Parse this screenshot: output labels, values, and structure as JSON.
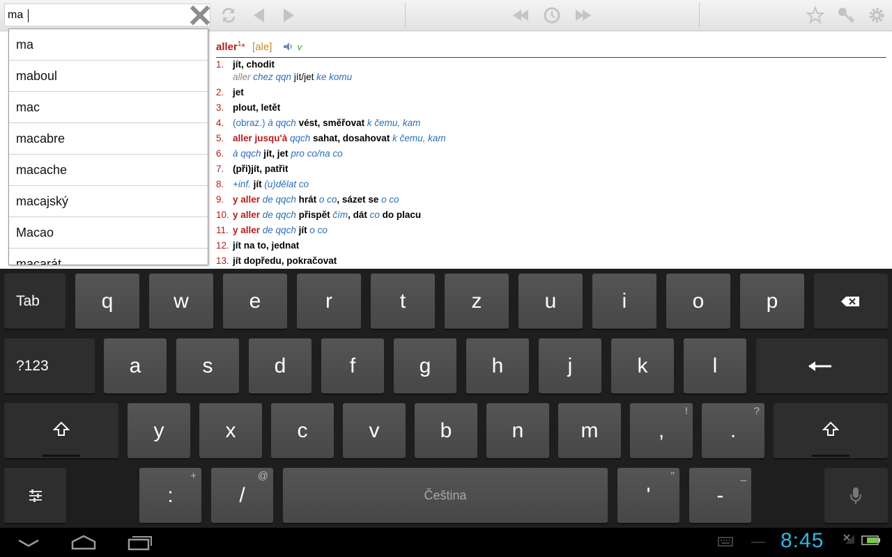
{
  "search": {
    "value": "ma"
  },
  "toolbar": {
    "icons": [
      "clear-icon",
      "refresh-icon",
      "back-arrow-icon",
      "forward-arrow-icon",
      "history-back-icon",
      "history-icon",
      "history-forward-icon",
      "star-icon",
      "key-icon",
      "gear-icon"
    ]
  },
  "entry": {
    "headword": "aller",
    "sup": "1",
    "star": "*",
    "pron": "[ale]",
    "pos": "v",
    "senses": [
      {
        "num": "1.",
        "parts": [
          [
            "b",
            "jít, chodit"
          ]
        ]
      },
      {
        "num": "",
        "parts": [
          [
            "gray",
            "aller "
          ],
          [
            "it",
            "chez qqn "
          ],
          [
            "plain",
            "jít/jet "
          ],
          [
            "it",
            "ke komu"
          ]
        ]
      },
      {
        "num": "2.",
        "parts": [
          [
            "b",
            "jet"
          ]
        ]
      },
      {
        "num": "3.",
        "parts": [
          [
            "b",
            "plout, letět"
          ]
        ]
      },
      {
        "num": "4.",
        "parts": [
          [
            "itn",
            "(obraz.) "
          ],
          [
            "it",
            "à qqch "
          ],
          [
            "b",
            "vést, směřovat "
          ],
          [
            "it",
            "k čemu, kam"
          ]
        ]
      },
      {
        "num": "5.",
        "parts": [
          [
            "red",
            "aller jusqu'à "
          ],
          [
            "it",
            "qqch "
          ],
          [
            "b",
            "sahat, dosahovat "
          ],
          [
            "it",
            "k čemu, kam"
          ]
        ]
      },
      {
        "num": "6.",
        "parts": [
          [
            "it",
            "à qqch "
          ],
          [
            "b",
            "jít, jet "
          ],
          [
            "it",
            "pro co/na co"
          ]
        ]
      },
      {
        "num": "7.",
        "parts": [
          [
            "b",
            "(při)jít, patřit"
          ]
        ]
      },
      {
        "num": "8.",
        "parts": [
          [
            "it",
            "+inf. "
          ],
          [
            "b",
            "jít "
          ],
          [
            "it",
            "(u)dělat co"
          ]
        ]
      },
      {
        "num": "9.",
        "parts": [
          [
            "red",
            "y aller "
          ],
          [
            "it",
            "de qqch "
          ],
          [
            "b",
            "hrát "
          ],
          [
            "it",
            "o co"
          ],
          [
            "b",
            ", sázet se "
          ],
          [
            "it",
            "o co"
          ]
        ]
      },
      {
        "num": "10.",
        "parts": [
          [
            "red",
            "y aller "
          ],
          [
            "it",
            "de qqch "
          ],
          [
            "b",
            "přispět "
          ],
          [
            "it",
            "čím"
          ],
          [
            "b",
            ", dát "
          ],
          [
            "it",
            "co "
          ],
          [
            "b",
            "do placu"
          ]
        ]
      },
      {
        "num": "11.",
        "parts": [
          [
            "red",
            "y aller "
          ],
          [
            "it",
            "de qqch "
          ],
          [
            "b",
            "jít "
          ],
          [
            "it",
            "o co"
          ]
        ]
      },
      {
        "num": "12.",
        "parts": [
          [
            "b",
            "jít na to, jednat"
          ]
        ]
      },
      {
        "num": "13.",
        "parts": [
          [
            "b",
            "jít dopředu, pokračovat"
          ]
        ]
      }
    ]
  },
  "suggestions": [
    "ma",
    "maboul",
    "mac",
    "macabre",
    "macache",
    "macajský",
    "Macao",
    "macarát"
  ],
  "keyboard": {
    "row1": [
      "Tab",
      "q",
      "w",
      "e",
      "r",
      "t",
      "z",
      "u",
      "i",
      "o",
      "p",
      "⌫"
    ],
    "row2": [
      "?123",
      "a",
      "s",
      "d",
      "f",
      "g",
      "h",
      "j",
      "k",
      "l",
      "←"
    ],
    "row3": [
      "⇧",
      "y",
      "x",
      "c",
      "v",
      "b",
      "n",
      "m",
      ",",
      ".",
      "⇧"
    ],
    "row3_hints": {
      ",": "!",
      ".": "?"
    },
    "row4": {
      "settings": "settings-icon",
      "colon": ":",
      "colon_hint": "+",
      "slash": "/",
      "slash_hint": "@",
      "space": "Čeština",
      "apos": "'",
      "apos_hint": "\"",
      "dash": "-",
      "dash_hint": "_",
      "mic": "microphone-icon"
    }
  },
  "navbar": {
    "clock": "8:45"
  },
  "colors": {
    "headword": "#b51c1c",
    "italic": "#2a6fb4",
    "clock": "#33b5e5",
    "pos": "#2d9a2d",
    "pron": "#c98a28"
  }
}
